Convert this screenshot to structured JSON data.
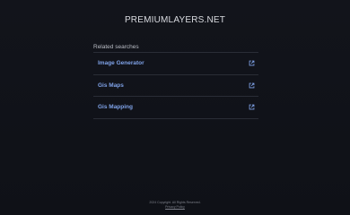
{
  "site": {
    "title": "PREMIUMLAYERS.NET"
  },
  "related": {
    "heading": "Related searches",
    "items": [
      {
        "label": "Image Generator",
        "icon": "external-link-icon"
      },
      {
        "label": "Gis Maps",
        "icon": "external-link-icon"
      },
      {
        "label": "Gis Mapping",
        "icon": "external-link-icon"
      }
    ]
  },
  "footer": {
    "copyright": "2024 Copyright. All Rights Reserved.",
    "privacy": "Privacy Policy"
  },
  "colors": {
    "background": "#101218",
    "link": "#7fa2e8",
    "divider": "#2a2d36"
  }
}
